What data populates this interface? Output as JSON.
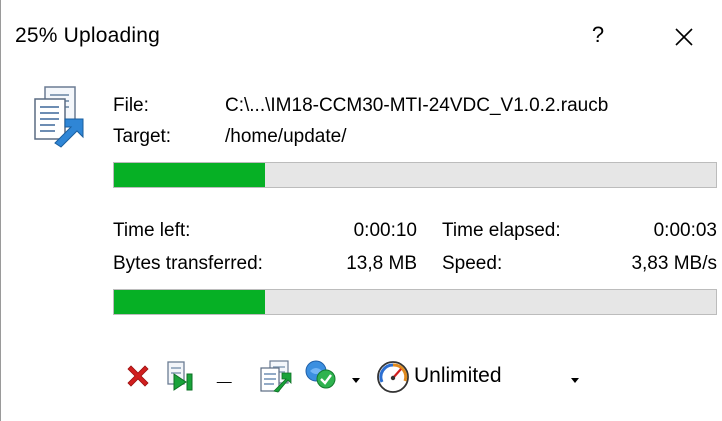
{
  "window": {
    "title": "25% Uploading",
    "help_label": "?"
  },
  "transfer": {
    "file_label": "File:",
    "file_value": "C:\\...\\IM18-CCM30-MTI-24VDC_V1.0.2.raucb",
    "target_label": "Target:",
    "target_value": "/home/update/",
    "file_progress": 0.25
  },
  "stats": {
    "time_left_label": "Time left:",
    "time_left_value": "0:00:10",
    "time_elapsed_label": "Time elapsed:",
    "time_elapsed_value": "0:00:03",
    "bytes_label": "Bytes transferred:",
    "bytes_value": "13,8 MB",
    "speed_label": "Speed:",
    "speed_value": "3,83 MB/s",
    "total_progress": 0.25
  },
  "toolbar": {
    "cancel_icon": "cancel-x-icon",
    "skip_icon": "skip-forward-icon",
    "minimize_label": "_",
    "background_icon": "copy-files-icon",
    "after_complete_icon": "checkmark-globe-icon",
    "speed_limit_icon": "speedometer-icon",
    "speed_limit_label": "Unlimited"
  },
  "colors": {
    "progress_fill": "#06b025",
    "progress_track": "#e6e6e6",
    "cancel_red": "#d11f1f"
  }
}
